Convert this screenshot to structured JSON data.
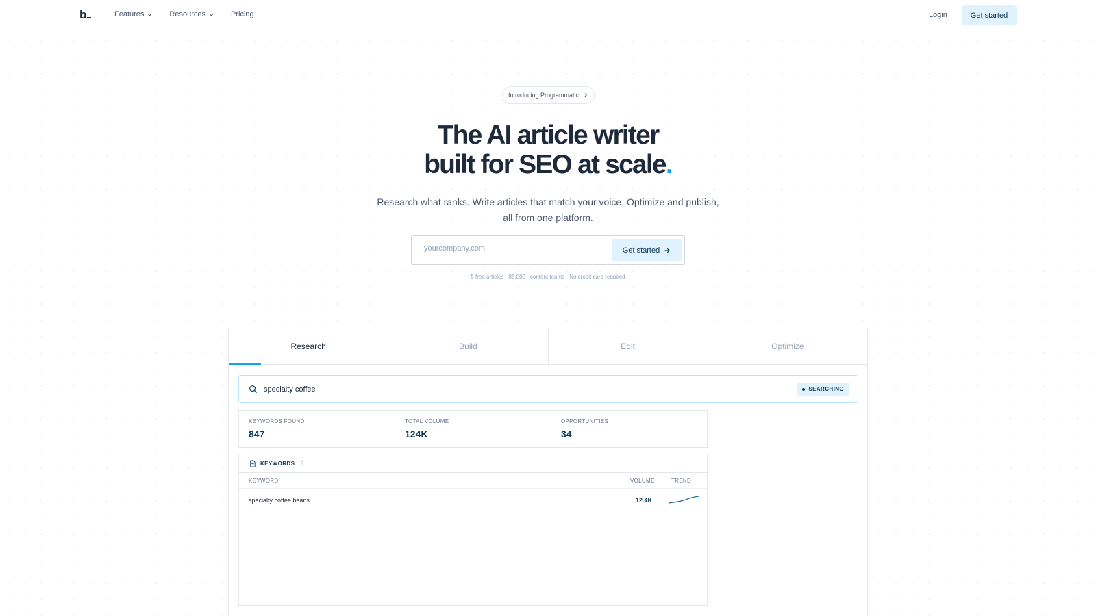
{
  "nav": {
    "logo": "b",
    "links": [
      {
        "label": "Features",
        "has_dropdown": true
      },
      {
        "label": "Resources",
        "has_dropdown": true
      },
      {
        "label": "Pricing",
        "has_dropdown": false
      }
    ],
    "login": "Login",
    "cta": "Get started"
  },
  "hero": {
    "badge": "Introducing Programmatic",
    "title_line1": "The AI article writer",
    "title_line2": "built for SEO at scale",
    "title_dot": ".",
    "subtitle": "Research what ranks. Write articles that match your voice. Optimize and publish, all from one platform.",
    "input_placeholder": "yourcompany.com",
    "button": "Get started",
    "footnote": "5 free articles · 85,000+ content teams · No credit card required"
  },
  "tabs": [
    {
      "label": "Research",
      "active": true
    },
    {
      "label": "Build",
      "active": false
    },
    {
      "label": "Edit",
      "active": false
    },
    {
      "label": "Optimize",
      "active": false
    }
  ],
  "research": {
    "query": "specialty coffee",
    "status": "SEARCHING",
    "stats": [
      {
        "label": "KEYWORDS FOUND",
        "value": "847"
      },
      {
        "label": "TOTAL VOLUME",
        "value": "124K"
      },
      {
        "label": "OPPORTUNITIES",
        "value": "34"
      }
    ],
    "keywords": {
      "title": "KEYWORDS",
      "count": "5",
      "columns": {
        "keyword": "KEYWORD",
        "volume": "VOLUME",
        "trend": "TREND"
      },
      "rows": [
        {
          "keyword": "specialty coffee beans",
          "volume": "12.4K",
          "trend_icon": "upward-sparkline"
        }
      ]
    }
  },
  "colors": {
    "accent": "#0ea5e9",
    "button_bg": "#e0f2fe",
    "dark": "#0f3b5c"
  }
}
